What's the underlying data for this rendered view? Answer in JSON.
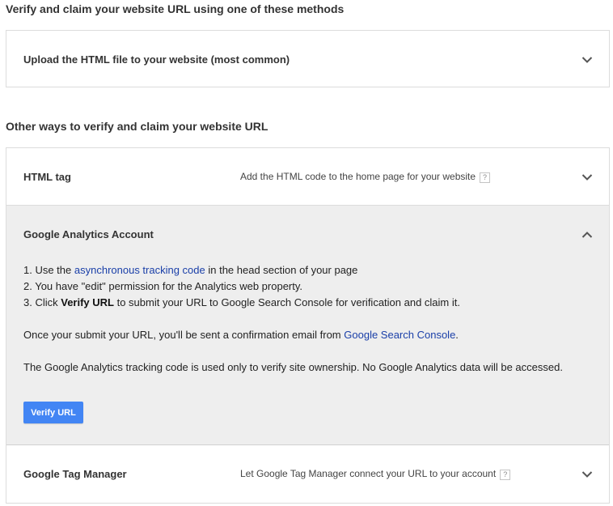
{
  "heading_primary": "Verify and claim your website URL using one of these methods",
  "primary_method": {
    "title": "Upload the HTML file to your website (most common)"
  },
  "heading_other": "Other ways to verify and claim your website URL",
  "methods": {
    "html_tag": {
      "title": "HTML tag",
      "description": "Add the HTML code to the home page for your website",
      "help": "?"
    },
    "google_analytics": {
      "title": "Google Analytics Account",
      "steps": [
        {
          "prefix": "1. Use the ",
          "link": "asynchronous tracking code",
          "suffix": " in the head section of your page"
        },
        {
          "text": "2. You have \"edit\" permission for the Analytics web property."
        },
        {
          "prefix": "3. Click ",
          "bold": "Verify URL",
          "suffix": " to submit your URL to Google Search Console for verification and claim it."
        }
      ],
      "confirmation": {
        "prefix": "Once your submit your URL, you'll be sent a confirmation email from ",
        "link": "Google Search Console",
        "suffix": "."
      },
      "notice": "The Google Analytics tracking code is used only to verify site ownership. No Google Analytics data will be accessed.",
      "verify_button": "Verify URL"
    },
    "gtm": {
      "title": "Google Tag Manager",
      "description": "Let Google Tag Manager connect your URL to your account",
      "help": "?"
    }
  },
  "colors": {
    "accent": "#4285f4",
    "link": "#1a3fa8",
    "expanded_bg": "#eeeeee"
  },
  "icons": {
    "collapsed": "chevron-down-icon",
    "expanded": "chevron-up-icon"
  }
}
